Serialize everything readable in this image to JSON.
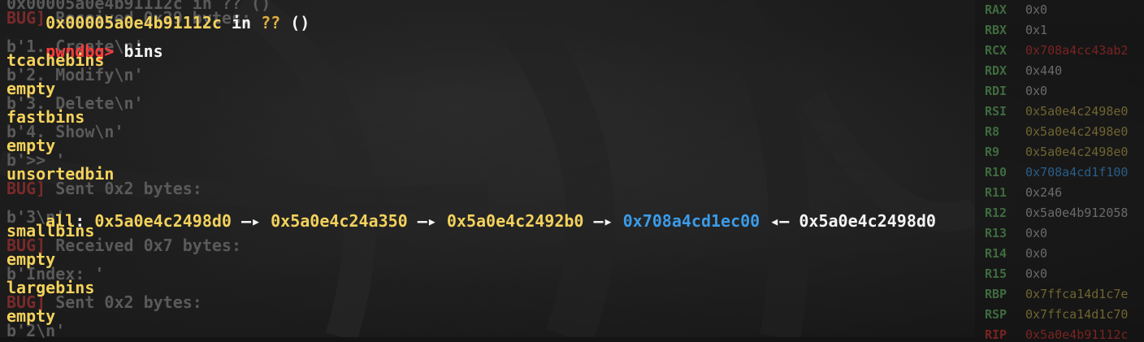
{
  "background_log": [
    {
      "bug": "",
      "text": "0x00005a0e4b91112c in ?? ()"
    },
    {
      "bug": "BUG]",
      "text": " Received 0x29 bytes:"
    },
    {
      "bug": "",
      "text": "b'1. Create\\n'"
    },
    {
      "bug": "",
      "text": "b'2. Modify\\n'"
    },
    {
      "bug": "",
      "text": "b'3. Delete\\n'"
    },
    {
      "bug": "",
      "text": "b'4. Show\\n'"
    },
    {
      "bug": "",
      "text": "b'>> '"
    },
    {
      "bug": "BUG]",
      "text": " Sent 0x2 bytes:"
    },
    {
      "bug": "",
      "text": "b'3\\n'"
    },
    {
      "bug": "BUG]",
      "text": " Received 0x7 bytes:"
    },
    {
      "bug": "",
      "text": "b'Index: '"
    },
    {
      "bug": "BUG]",
      "text": " Sent 0x2 bytes:"
    },
    {
      "bug": "",
      "text": "b'2\\n'"
    }
  ],
  "terminal": {
    "top_line_addr": "0x00005a0e4b91112c",
    "top_line_in": " in ",
    "top_line_qq": "??",
    "top_line_paren": " ()",
    "prompt": "pwndbg>",
    "command": " bins",
    "tcache_header": "tcachebins",
    "tcache_value": "empty",
    "fast_header": "fastbins",
    "fast_value": "empty",
    "unsorted_header": "unsortedbin",
    "unsorted_all_label": "all",
    "unsorted_all_colon": ":",
    "chain": [
      {
        "addr": "0x5a0e4c2498d0",
        "color": "#f3d25c"
      },
      {
        "addr": "0x5a0e4c24a350",
        "color": "#f3d25c"
      },
      {
        "addr": "0x5a0e4c2492b0",
        "color": "#f3d25c"
      },
      {
        "addr": "0x708a4cd1ec00",
        "color": "#3b9be8"
      },
      {
        "addr": "0x5a0e4c2498d0",
        "color": "#f5f5f5"
      }
    ],
    "arrow_right": "—▸",
    "arrow_left": "◂—",
    "small_header": "smallbins",
    "small_value": "empty",
    "large_header": "largebins",
    "large_value": "empty"
  },
  "registers": [
    {
      "name": "RAX",
      "value": "0x0",
      "style": ""
    },
    {
      "name": "RBX",
      "value": "0x1",
      "style": ""
    },
    {
      "name": "RCX",
      "value": "0x708a4cc43ab2",
      "style": "red"
    },
    {
      "name": "RDX",
      "value": "0x440",
      "style": ""
    },
    {
      "name": "RDI",
      "value": "0x0",
      "style": ""
    },
    {
      "name": "RSI",
      "value": "0x5a0e4c2498e0",
      "style": "amber"
    },
    {
      "name": "R8",
      "value": "0x5a0e4c2498e0",
      "style": "amber"
    },
    {
      "name": "R9",
      "value": "0x5a0e4c2498e0",
      "style": "amber"
    },
    {
      "name": "R10",
      "value": "0x708a4cd1f100",
      "style": "blue"
    },
    {
      "name": "R11",
      "value": "0x246",
      "style": ""
    },
    {
      "name": "R12",
      "value": "0x5a0e4b912058",
      "style": ""
    },
    {
      "name": "R13",
      "value": "0x0",
      "style": ""
    },
    {
      "name": "R14",
      "value": "0x0",
      "style": ""
    },
    {
      "name": "R15",
      "value": "0x0",
      "style": ""
    },
    {
      "name": "RBP",
      "value": "0x7ffca14d1c7e",
      "style": "amber"
    },
    {
      "name": "RSP",
      "value": "0x7ffca14d1c70",
      "style": "amber"
    },
    {
      "name": "RIP",
      "value": "0x5a0e4b91112c",
      "style": "red"
    }
  ],
  "colors": {
    "yellow": "#f3d25c",
    "white": "#f5f5f5",
    "prompt_red": "#ff3b3b",
    "libc_blue": "#3b9be8"
  }
}
